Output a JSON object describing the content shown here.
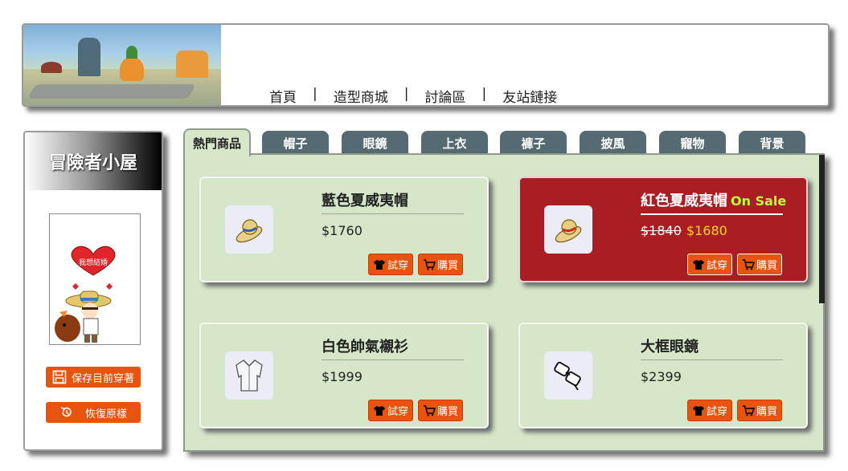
{
  "nav": {
    "items": [
      "首頁",
      "造型商城",
      "討論區",
      "友站鏈接"
    ],
    "separator": "|"
  },
  "sidebar": {
    "title": "冒險者小屋",
    "save_label": "保存目前穿著",
    "restore_label": "恢復原樣",
    "avatar_text": "我想結婚"
  },
  "tabs": [
    "熱門商品",
    "帽子",
    "眼鏡",
    "上衣",
    "褲子",
    "披風",
    "寵物",
    "背景"
  ],
  "active_tab": 0,
  "products": [
    {
      "name": "藍色夏威夷帽",
      "price": "$1760",
      "on_sale": false,
      "icon": "straw-hat-icon"
    },
    {
      "name": "紅色夏威夷帽",
      "badge": "On Sale",
      "old_price": "$1840",
      "new_price": "$1680",
      "on_sale": true,
      "icon": "straw-hat-icon"
    },
    {
      "name": "白色帥氣襯衫",
      "price": "$1999",
      "on_sale": false,
      "icon": "shirt-icon"
    },
    {
      "name": "大框眼鏡",
      "price": "$2399",
      "on_sale": false,
      "icon": "glasses-icon"
    }
  ],
  "buttons": {
    "try_on": "試穿",
    "buy": "購買"
  },
  "colors": {
    "accent": "#e8540f",
    "panel": "#d6e6c9",
    "tab": "#556a73",
    "sale": "#aa1d22",
    "sale_badge": "#b6ff3a",
    "sale_price": "#ffd528"
  }
}
